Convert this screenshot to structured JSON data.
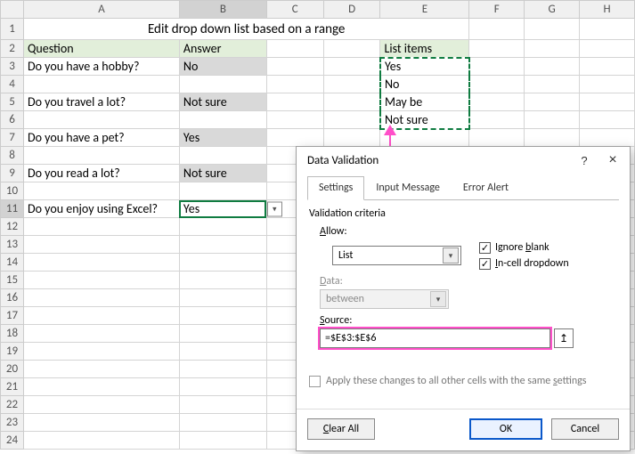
{
  "columns": [
    "A",
    "B",
    "C",
    "D",
    "E",
    "F",
    "G",
    "H"
  ],
  "rows_count": 24,
  "title": "Edit drop down list based on a range",
  "headers": {
    "question": "Question",
    "answer": "Answer",
    "list_items": "List items"
  },
  "qa": [
    {
      "r": 3,
      "q": "Do you have a hobby?",
      "a": "No",
      "shade": true
    },
    {
      "r": 5,
      "q": "Do you travel a lot?",
      "a": "Not sure",
      "shade": true
    },
    {
      "r": 7,
      "q": "Do you have a pet?",
      "a": "Yes",
      "shade": true
    },
    {
      "r": 9,
      "q": "Do you read a lot?",
      "a": "Not sure",
      "shade": true
    },
    {
      "r": 11,
      "q": "Do you enjoy using Excel?",
      "a": "Yes",
      "shade": false,
      "active": true
    }
  ],
  "list_items": [
    "Yes",
    "No",
    "May be",
    "Not sure"
  ],
  "dialog": {
    "title": "Data Validation",
    "tabs": [
      "Settings",
      "Input Message",
      "Error Alert"
    ],
    "criteria_label": "Validation criteria",
    "allow_label": "Allow:",
    "allow_value": "List",
    "data_label": "Data:",
    "data_value": "between",
    "source_label": "Source:",
    "source_value": "=$E$3:$E$6",
    "ignore_blank": "Ignore blank",
    "incell_dd": "In-cell dropdown",
    "apply_label": "Apply these changes to all other cells with the same settings",
    "clear": "Clear All",
    "ok": "OK",
    "cancel": "Cancel"
  }
}
